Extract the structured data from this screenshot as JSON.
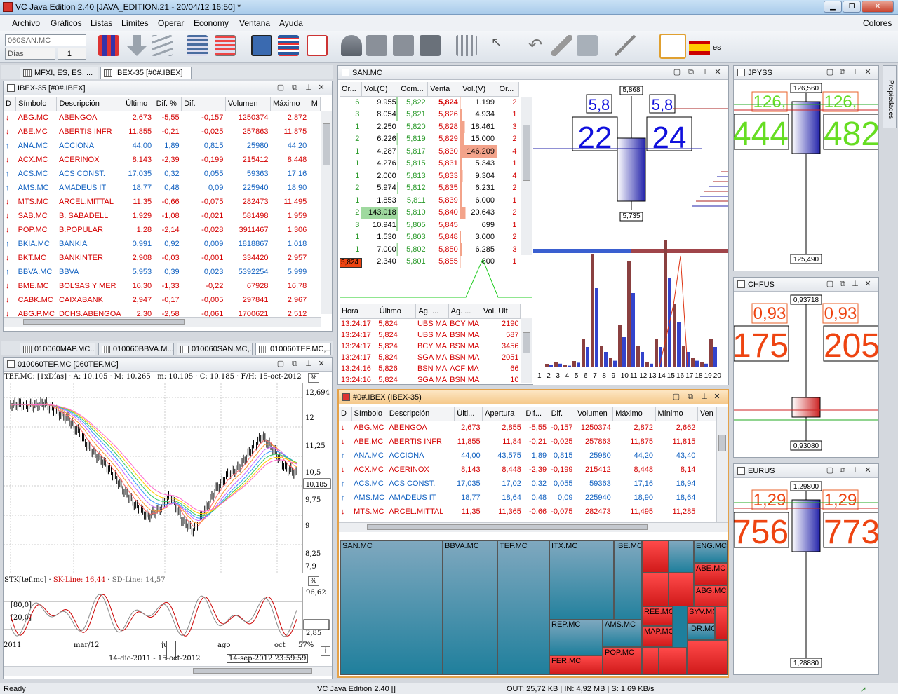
{
  "window": {
    "title": "VC Java Edition 2.40 [JAVA_EDITION.21 - 20/04/12 16:50] *"
  },
  "menu": [
    "Archivo",
    "Gráficos",
    "Listas",
    "Límites",
    "Operar",
    "Economy",
    "Ventana",
    "Ayuda"
  ],
  "menu_right": "Colores",
  "toolbar": {
    "symbol": "060SAN.MC",
    "period": "Días",
    "period_n": "1",
    "lang": "es"
  },
  "left_tabs": [
    "MFXI, ES, ES, ...",
    "IBEX-35 [#0#.IBEX]"
  ],
  "ibex_panel": {
    "title": "IBEX-35 [#0#.IBEX]",
    "headers": [
      "D",
      "Símbolo",
      "Descripción",
      "Último",
      "Dif. %",
      "Dif.",
      "Volumen",
      "Máximo",
      "M"
    ],
    "rows": [
      [
        "↓",
        "ABG.MC",
        "ABENGOA",
        "2,673",
        "-5,55",
        "-0,157",
        "1250374",
        "2,872",
        "red"
      ],
      [
        "↓",
        "ABE.MC",
        "ABERTIS INFR",
        "11,855",
        "-0,21",
        "-0,025",
        "257863",
        "11,875",
        "red"
      ],
      [
        "↑",
        "ANA.MC",
        "ACCIONA",
        "44,00",
        "1,89",
        "0,815",
        "25980",
        "44,20",
        "blue"
      ],
      [
        "↓",
        "ACX.MC",
        "ACERINOX",
        "8,143",
        "-2,39",
        "-0,199",
        "215412",
        "8,448",
        "red"
      ],
      [
        "↑",
        "ACS.MC",
        "ACS CONST.",
        "17,035",
        "0,32",
        "0,055",
        "59363",
        "17,16",
        "blue"
      ],
      [
        "↑",
        "AMS.MC",
        "AMADEUS IT",
        "18,77",
        "0,48",
        "0,09",
        "225940",
        "18,90",
        "blue"
      ],
      [
        "↓",
        "MTS.MC",
        "ARCEL.MITTAL",
        "11,35",
        "-0,66",
        "-0,075",
        "282473",
        "11,495",
        "red"
      ],
      [
        "↓",
        "SAB.MC",
        "B. SABADELL",
        "1,929",
        "-1,08",
        "-0,021",
        "581498",
        "1,959",
        "red"
      ],
      [
        "↓",
        "POP.MC",
        "B.POPULAR",
        "1,28",
        "-2,14",
        "-0,028",
        "3911467",
        "1,306",
        "red"
      ],
      [
        "↑",
        "BKIA.MC",
        "BANKIA",
        "0,991",
        "0,92",
        "0,009",
        "1818867",
        "1,018",
        "blue"
      ],
      [
        "↓",
        "BKT.MC",
        "BANKINTER",
        "2,908",
        "-0,03",
        "-0,001",
        "334420",
        "2,957",
        "red"
      ],
      [
        "↑",
        "BBVA.MC",
        "BBVA",
        "5,953",
        "0,39",
        "0,023",
        "5392254",
        "5,999",
        "blue"
      ],
      [
        "↓",
        "BME.MC",
        "BOLSAS Y MER",
        "16,30",
        "-1,33",
        "-0,22",
        "67928",
        "16,78",
        "red"
      ],
      [
        "↓",
        "CABK.MC",
        "CAIXABANK",
        "2,947",
        "-0,17",
        "-0,005",
        "297841",
        "2,967",
        "red"
      ],
      [
        "↓",
        "ABG.P.MC",
        "DCHS.ABENGOA",
        "2,30",
        "-2,58",
        "-0,061",
        "1700621",
        "2,512",
        "red"
      ]
    ]
  },
  "chart_tabs": [
    "010060MAP.MC...",
    "010060BBVA.M...",
    "010060SAN.MC,...",
    "010060TEF.MC,..."
  ],
  "chart_panel": {
    "title": "010060TEF.MC [060TEF.MC]",
    "info": "TEF.MC: [1xDías] · A: 10.105 · M: 10.265 · m: 10.105 · C: 10.185 · F/H: 15-oct-2012",
    "price_ticks": [
      "12,694",
      "12",
      "11,25",
      "10,5",
      "10,185",
      "9,75",
      "9",
      "8,25",
      "7,9"
    ],
    "stk_label": "STK[tef.mc]",
    "sk_line": "SK-Line: 16,44",
    "sd_line": "SD-Line: 14,57",
    "stk_ticks": [
      "96,62",
      "16,44",
      "2,85"
    ],
    "stk_left": [
      "[80,0]",
      "[20,0]"
    ],
    "x_ticks": [
      "2011",
      "mar/12",
      "jun",
      "ago",
      "oct"
    ],
    "range": "14-dic-2011 - 15-oct-2012",
    "cursor": "14-sep-2012 23:59:59",
    "zoom": "57%"
  },
  "san_panel": {
    "title": "SAN.MC",
    "book_headers": [
      "Or...",
      "Vol.(C)",
      "Com...",
      "Venta",
      "Vol.(V)",
      "Or..."
    ],
    "book": [
      [
        "6",
        "9.955",
        "5,822",
        "5,824",
        "1.199",
        "2"
      ],
      [
        "3",
        "8.054",
        "5,821",
        "5,826",
        "4.934",
        "1"
      ],
      [
        "1",
        "2.250",
        "5,820",
        "5,828",
        "18.461",
        "3"
      ],
      [
        "2",
        "6.226",
        "5,819",
        "5,829",
        "15.000",
        "2"
      ],
      [
        "1",
        "4.287",
        "5,817",
        "5,830",
        "146.209",
        "4"
      ],
      [
        "1",
        "4.276",
        "5,815",
        "5,831",
        "5.343",
        "1"
      ],
      [
        "1",
        "2.000",
        "5,813",
        "5,833",
        "9.304",
        "4"
      ],
      [
        "2",
        "5.974",
        "5,812",
        "5,835",
        "6.231",
        "2"
      ],
      [
        "1",
        "1.853",
        "5,811",
        "5,839",
        "6.000",
        "1"
      ],
      [
        "2",
        "143.018",
        "5,810",
        "5,840",
        "20.643",
        "2"
      ],
      [
        "3",
        "10.941",
        "5,805",
        "5,845",
        "699",
        "1"
      ],
      [
        "1",
        "1.530",
        "5,803",
        "5,848",
        "3.000",
        "2"
      ],
      [
        "1",
        "7.000",
        "5,802",
        "5,850",
        "6.285",
        "3"
      ],
      [
        "2",
        "2.340",
        "5,801",
        "5,855",
        "800",
        "1"
      ]
    ],
    "last_price": "5,824",
    "trade_headers": [
      "Hora",
      "Último",
      "Ag. ...",
      "Ag. ...",
      "Vol. Ult"
    ],
    "trades": [
      [
        "13:24:17",
        "5,824",
        "UBS MA",
        "BCY MA",
        "2190"
      ],
      [
        "13:24:17",
        "5,824",
        "UBS MA",
        "BSN MA",
        "587"
      ],
      [
        "13:24:17",
        "5,824",
        "BCY MA",
        "BSN MA",
        "3456"
      ],
      [
        "13:24:17",
        "5,824",
        "SGA MA",
        "BSN MA",
        "2051"
      ],
      [
        "13:24:16",
        "5,826",
        "BSN MA",
        "ACF MA",
        "66"
      ],
      [
        "13:24:16",
        "5,824",
        "SGA MA",
        "BSN MA",
        "10"
      ]
    ],
    "candle": {
      "high": "5,868",
      "low": "5,735",
      "bid_small": "5,8",
      "ask_small": "5,8",
      "bid_big": "22",
      "ask_big": "24"
    },
    "hist_x": [
      "1",
      "2",
      "3",
      "4",
      "5",
      "6",
      "7",
      "8",
      "9",
      "10",
      "11",
      "12",
      "13",
      "14",
      "15",
      "16",
      "17",
      "18",
      "19",
      "20"
    ]
  },
  "ibex_bottom": {
    "title": "#0#.IBEX (IBEX-35)",
    "headers": [
      "D",
      "Símbolo",
      "Descripción",
      "Últi...",
      "Apertura",
      "Dif...",
      "Dif.",
      "Volumen",
      "Máximo",
      "Mínimo",
      "Ven"
    ],
    "rows": [
      [
        "↓",
        "ABG.MC",
        "ABENGOA",
        "2,673",
        "2,855",
        "-5,55",
        "-0,157",
        "1250374",
        "2,872",
        "2,662",
        "red"
      ],
      [
        "↓",
        "ABE.MC",
        "ABERTIS INFR",
        "11,855",
        "11,84",
        "-0,21",
        "-0,025",
        "257863",
        "11,875",
        "11,815",
        "red"
      ],
      [
        "↑",
        "ANA.MC",
        "ACCIONA",
        "44,00",
        "43,575",
        "1,89",
        "0,815",
        "25980",
        "44,20",
        "43,40",
        "blue"
      ],
      [
        "↓",
        "ACX.MC",
        "ACERINOX",
        "8,143",
        "8,448",
        "-2,39",
        "-0,199",
        "215412",
        "8,448",
        "8,14",
        "red"
      ],
      [
        "↑",
        "ACS.MC",
        "ACS CONST.",
        "17,035",
        "17,02",
        "0,32",
        "0,055",
        "59363",
        "17,16",
        "16,94",
        "blue"
      ],
      [
        "↑",
        "AMS.MC",
        "AMADEUS IT",
        "18,77",
        "18,64",
        "0,48",
        "0,09",
        "225940",
        "18,90",
        "18,64",
        "blue"
      ],
      [
        "↓",
        "MTS.MC",
        "ARCEL.MITTAL",
        "11,35",
        "11,365",
        "-0,66",
        "-0,075",
        "282473",
        "11,495",
        "11,285",
        "red"
      ]
    ]
  },
  "treemap": [
    "SAN.MC",
    "BBVA.MC",
    "TEF.MC",
    "ITX.MC",
    "IBE.MC",
    "ENG.MC",
    "ABE.MC",
    "ABG.MC",
    "REP.MC",
    "AMS.MC",
    "REE.MC",
    "SYV.MC",
    "MAP.MC",
    "IDR.MC",
    "FER.MC",
    "POP.MC"
  ],
  "fx": [
    {
      "name": "JPYSS",
      "high": "126,560",
      "low": "125,490",
      "bs": "126,",
      "as": "126,",
      "bb": "444",
      "ab": "482",
      "color": "#66dd22"
    },
    {
      "name": "CHFUS",
      "high": "0,93718",
      "low": "0,93080",
      "bs": "0,93",
      "as": "0,93",
      "bb": "175",
      "ab": "205",
      "color": "#ee4411"
    },
    {
      "name": "EURUS",
      "high": "1,29800",
      "low": "1,28880",
      "bs": "1,29",
      "as": "1,29",
      "bb": "756",
      "ab": "773",
      "color": "#ee4411"
    }
  ],
  "side_tab": "Propiedades",
  "status": {
    "left": "Ready",
    "center": "VC Java Edition 2.40 []",
    "right": "OUT: 25,72 KB | IN: 4,92 MB | S: 1,69 KB/s"
  }
}
